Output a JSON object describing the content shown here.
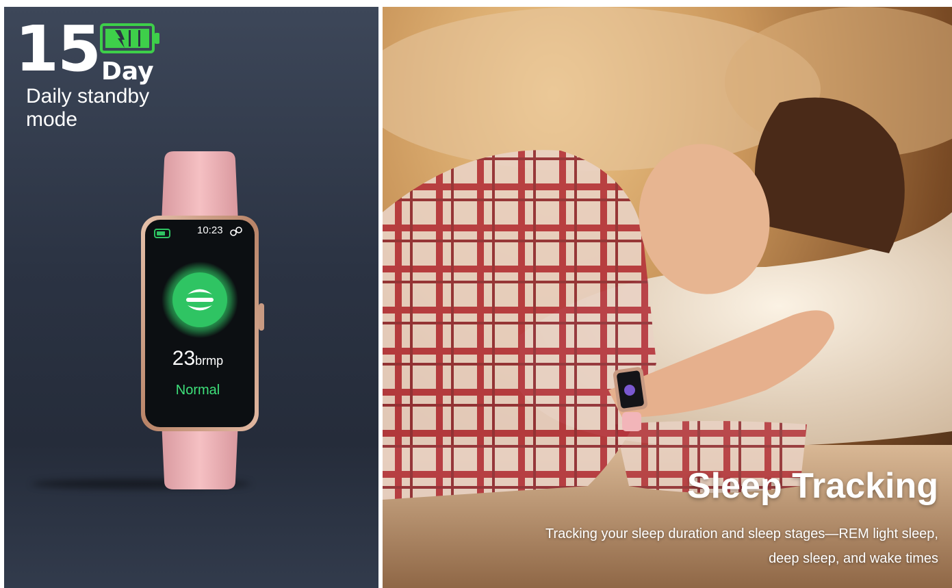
{
  "standby_panel": {
    "days_number": "15",
    "days_unit": "Day",
    "caption": "Daily standby mode",
    "battery_icon": "battery-charging-icon",
    "battery_color": "#3ecf4a",
    "watch": {
      "time": "10:23",
      "reading_value": "23",
      "reading_unit": "brmp",
      "status": "Normal",
      "band_color": "#f2b5b9",
      "frame_color": "#c89a82",
      "accent_color": "#2fc463",
      "icons": [
        "watch-battery-icon",
        "link-icon",
        "lungs-icon"
      ]
    }
  },
  "sleep_panel": {
    "headline": "Sleep Tracking",
    "description": "Tracking your sleep duration and sleep stages—REM light sleep, deep sleep, and wake times"
  }
}
